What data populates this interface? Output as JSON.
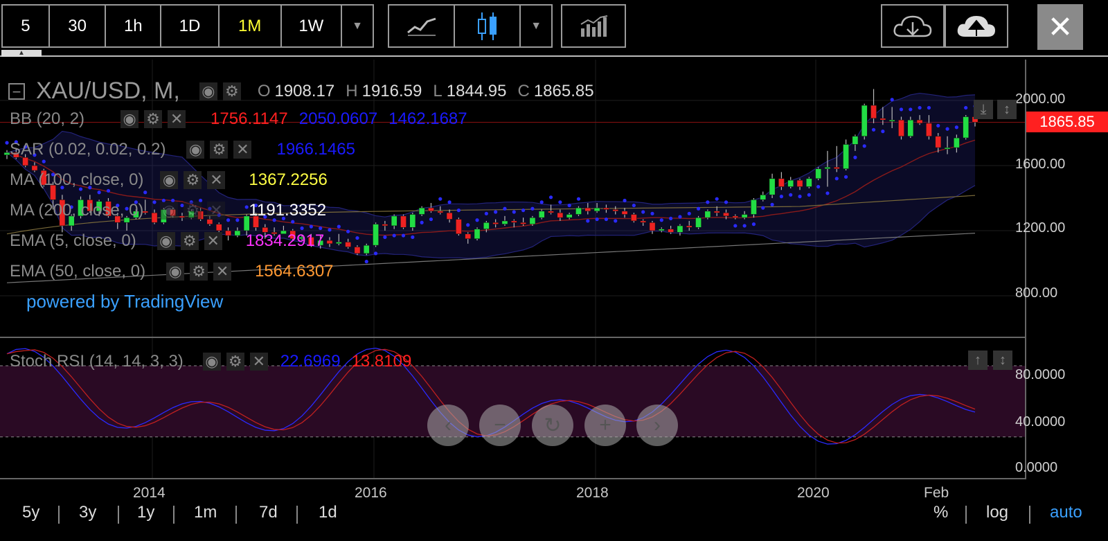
{
  "toolbar": {
    "timeframes": [
      "5",
      "30",
      "1h",
      "1D",
      "1M",
      "1W"
    ],
    "active": "1M",
    "close_symbol": "✕"
  },
  "header": {
    "symbol": "XAU/USD, M,",
    "open_label": "O",
    "open": "1908.17",
    "high_label": "H",
    "high": "1916.59",
    "low_label": "L",
    "low": "1844.95",
    "close_label": "C",
    "close": "1865.85"
  },
  "indicators": [
    {
      "label": "BB (20, 2)",
      "values": [
        "1756.1147",
        "2050.0607",
        "1462.1687"
      ],
      "colors": [
        "#ff2020",
        "#1a1aff",
        "#1a1aff"
      ]
    },
    {
      "label": "SAR (0.02, 0.02, 0.2)",
      "values": [
        "1966.1465"
      ],
      "colors": [
        "#1a1aff"
      ]
    },
    {
      "label": "MA (100, close, 0)",
      "values": [
        "1367.2256"
      ],
      "colors": [
        "#ffff44"
      ]
    },
    {
      "label": "MA (200, close, 0)",
      "values": [
        "1191.3352"
      ],
      "colors": [
        "#ffffff"
      ]
    },
    {
      "label": "EMA (5, close, 0)",
      "values": [
        "1834.2917"
      ],
      "colors": [
        "#ff33ff"
      ]
    },
    {
      "label": "EMA (50, close, 0)",
      "values": [
        "1564.6307"
      ],
      "colors": [
        "#ff9933"
      ]
    }
  ],
  "powered": "powered by TradingView",
  "price_axis": [
    "2000.00",
    "1600.00",
    "1200.00",
    "800.00"
  ],
  "last_price": "1865.85",
  "stoch": {
    "label": "Stoch RSI (14, 14, 3, 3)",
    "k": "22.6969",
    "d": "13.8109"
  },
  "stoch_axis": [
    "80.0000",
    "40.0000",
    "0.0000"
  ],
  "x_axis": [
    "2014",
    "2016",
    "2018",
    "2020",
    "Feb"
  ],
  "ranges": [
    "5y",
    "3y",
    "1y",
    "1m",
    "7d",
    "1d"
  ],
  "modes": [
    "%",
    "log",
    "auto"
  ],
  "nav": [
    "‹",
    "−",
    "↻",
    "+",
    "›"
  ],
  "colors": {
    "up": "#22dd44",
    "down": "#ee2222",
    "accent_blue": "#3aa0ff",
    "active_tf": "#ffff33"
  },
  "chart_data": {
    "type": "candlestick",
    "ylim": [
      700,
      2080
    ],
    "candles": [
      [
        1665,
        1695,
        1640,
        1680
      ],
      [
        1680,
        1700,
        1640,
        1650
      ],
      [
        1650,
        1670,
        1590,
        1600
      ],
      [
        1600,
        1620,
        1560,
        1570
      ],
      [
        1570,
        1580,
        1470,
        1480
      ],
      [
        1480,
        1500,
        1330,
        1390
      ],
      [
        1390,
        1420,
        1190,
        1230
      ],
      [
        1230,
        1300,
        1200,
        1290
      ],
      [
        1290,
        1410,
        1275,
        1390
      ],
      [
        1390,
        1420,
        1310,
        1320
      ],
      [
        1320,
        1390,
        1290,
        1380
      ],
      [
        1380,
        1400,
        1280,
        1290
      ],
      [
        1290,
        1310,
        1210,
        1250
      ],
      [
        1250,
        1290,
        1200,
        1280
      ],
      [
        1280,
        1330,
        1270,
        1320
      ],
      [
        1320,
        1390,
        1300,
        1310
      ],
      [
        1310,
        1330,
        1240,
        1250
      ],
      [
        1250,
        1340,
        1240,
        1330
      ],
      [
        1330,
        1340,
        1280,
        1290
      ],
      [
        1290,
        1310,
        1260,
        1280
      ],
      [
        1280,
        1330,
        1270,
        1320
      ],
      [
        1320,
        1340,
        1260,
        1270
      ],
      [
        1270,
        1290,
        1230,
        1240
      ],
      [
        1240,
        1250,
        1180,
        1200
      ],
      [
        1200,
        1220,
        1140,
        1170
      ],
      [
        1170,
        1220,
        1160,
        1200
      ],
      [
        1200,
        1300,
        1170,
        1290
      ],
      [
        1290,
        1310,
        1200,
        1220
      ],
      [
        1220,
        1240,
        1150,
        1190
      ],
      [
        1190,
        1220,
        1170,
        1180
      ],
      [
        1180,
        1230,
        1180,
        1200
      ],
      [
        1200,
        1210,
        1140,
        1150
      ],
      [
        1150,
        1170,
        1140,
        1160
      ],
      [
        1160,
        1180,
        1100,
        1110
      ],
      [
        1110,
        1170,
        1090,
        1140
      ],
      [
        1140,
        1160,
        1100,
        1120
      ],
      [
        1120,
        1180,
        1110,
        1130
      ],
      [
        1130,
        1150,
        1090,
        1100
      ],
      [
        1100,
        1110,
        1050,
        1060
      ],
      [
        1060,
        1120,
        1050,
        1110
      ],
      [
        1110,
        1250,
        1100,
        1240
      ],
      [
        1240,
        1260,
        1200,
        1230
      ],
      [
        1230,
        1300,
        1210,
        1290
      ],
      [
        1290,
        1300,
        1210,
        1220
      ],
      [
        1220,
        1310,
        1200,
        1300
      ],
      [
        1300,
        1350,
        1290,
        1340
      ],
      [
        1340,
        1370,
        1310,
        1320
      ],
      [
        1320,
        1350,
        1300,
        1310
      ],
      [
        1310,
        1330,
        1250,
        1270
      ],
      [
        1270,
        1280,
        1170,
        1180
      ],
      [
        1180,
        1190,
        1120,
        1150
      ],
      [
        1150,
        1220,
        1140,
        1210
      ],
      [
        1210,
        1260,
        1190,
        1250
      ],
      [
        1250,
        1270,
        1220,
        1240
      ],
      [
        1240,
        1290,
        1230,
        1260
      ],
      [
        1260,
        1270,
        1220,
        1250
      ],
      [
        1250,
        1280,
        1230,
        1240
      ],
      [
        1240,
        1290,
        1230,
        1280
      ],
      [
        1280,
        1330,
        1270,
        1320
      ],
      [
        1320,
        1360,
        1300,
        1310
      ],
      [
        1310,
        1330,
        1260,
        1280
      ],
      [
        1280,
        1310,
        1270,
        1300
      ],
      [
        1300,
        1350,
        1290,
        1340
      ],
      [
        1340,
        1370,
        1300,
        1320
      ],
      [
        1320,
        1370,
        1310,
        1340
      ],
      [
        1340,
        1360,
        1310,
        1330
      ],
      [
        1330,
        1350,
        1300,
        1320
      ],
      [
        1320,
        1340,
        1280,
        1300
      ],
      [
        1300,
        1310,
        1250,
        1260
      ],
      [
        1260,
        1270,
        1230,
        1250
      ],
      [
        1250,
        1260,
        1180,
        1200
      ],
      [
        1200,
        1220,
        1190,
        1210
      ],
      [
        1210,
        1230,
        1180,
        1190
      ],
      [
        1190,
        1240,
        1170,
        1230
      ],
      [
        1230,
        1260,
        1200,
        1220
      ],
      [
        1220,
        1290,
        1210,
        1280
      ],
      [
        1280,
        1330,
        1270,
        1320
      ],
      [
        1320,
        1350,
        1290,
        1310
      ],
      [
        1310,
        1330,
        1270,
        1290
      ],
      [
        1290,
        1300,
        1270,
        1280
      ],
      [
        1280,
        1320,
        1270,
        1300
      ],
      [
        1300,
        1400,
        1280,
        1390
      ],
      [
        1390,
        1440,
        1380,
        1420
      ],
      [
        1420,
        1550,
        1400,
        1520
      ],
      [
        1520,
        1560,
        1450,
        1470
      ],
      [
        1470,
        1530,
        1460,
        1510
      ],
      [
        1510,
        1520,
        1450,
        1470
      ],
      [
        1470,
        1530,
        1460,
        1520
      ],
      [
        1520,
        1590,
        1510,
        1580
      ],
      [
        1580,
        1690,
        1470,
        1590
      ],
      [
        1590,
        1720,
        1560,
        1580
      ],
      [
        1580,
        1760,
        1570,
        1730
      ],
      [
        1730,
        1790,
        1690,
        1780
      ],
      [
        1780,
        1980,
        1760,
        1970
      ],
      [
        1970,
        2070,
        1860,
        1890
      ],
      [
        1890,
        1960,
        1850,
        1880
      ],
      [
        1880,
        1960,
        1830,
        1880
      ],
      [
        1880,
        1900,
        1760,
        1780
      ],
      [
        1780,
        1900,
        1770,
        1880
      ],
      [
        1880,
        1910,
        1850,
        1860
      ],
      [
        1860,
        1910,
        1760,
        1780
      ],
      [
        1780,
        1800,
        1680,
        1710
      ],
      [
        1710,
        1780,
        1670,
        1710
      ],
      [
        1710,
        1790,
        1680,
        1770
      ],
      [
        1770,
        1910,
        1760,
        1900
      ],
      [
        1900,
        1920,
        1840,
        1866
      ]
    ]
  }
}
